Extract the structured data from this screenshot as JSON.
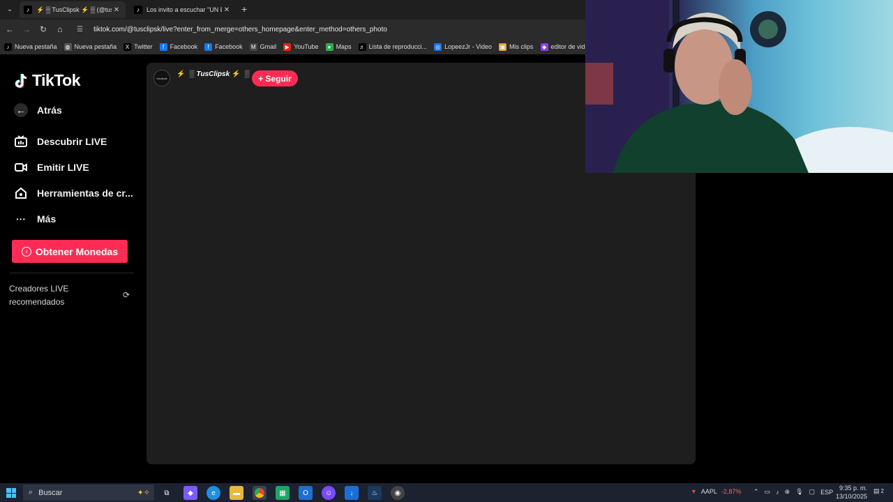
{
  "browser": {
    "tabs": [
      {
        "title": "⚡ ▒ TusClipsk ⚡ ▒ (@tusc",
        "active": true
      },
      {
        "title": "Los invito a escuchar \"UN ESCA",
        "active": false
      }
    ],
    "new_tab": "+",
    "url": "tiktok.com/@tusclipsk/live?enter_from_merge=others_homepage&enter_method=others_photo",
    "bookmarks": [
      {
        "label": "Nueva pestaña",
        "icon": "tiktok-icon"
      },
      {
        "label": "Nueva pestaña",
        "icon": "globe-icon"
      },
      {
        "label": "Twitter",
        "icon": "x-icon"
      },
      {
        "label": "Facebook",
        "icon": "facebook-icon"
      },
      {
        "label": "Facebook",
        "icon": "facebook-icon"
      },
      {
        "label": "Gmail",
        "icon": "gmail-icon"
      },
      {
        "label": "YouTube",
        "icon": "youtube-icon"
      },
      {
        "label": "Maps",
        "icon": "maps-icon"
      },
      {
        "label": "Lista de reproducci...",
        "icon": "list-icon"
      },
      {
        "label": "LopeezJr - Video",
        "icon": "chrome-icon"
      },
      {
        "label": "Mis clips",
        "icon": "clips-icon"
      },
      {
        "label": "editor de videos onl...",
        "icon": "editor-icon"
      },
      {
        "label": "",
        "icon": "px-icon"
      }
    ]
  },
  "tiktok": {
    "logo": "TikTok",
    "back": "Atrás",
    "nav": [
      {
        "label": "Descubrir LIVE",
        "icon": "live-tv-icon"
      },
      {
        "label": "Emitir LIVE",
        "icon": "camera-icon"
      },
      {
        "label": "Herramientas de cr...",
        "icon": "home-tools-icon"
      },
      {
        "label": "Más",
        "icon": "more-icon"
      }
    ],
    "coins_button": "Obtener Monedas",
    "recommended_title": "Creadores LIVE recomendados",
    "stream": {
      "streamer_name": "TusClipsk",
      "follow_label": "+ Seguir",
      "avatar_text": "tusclipsk"
    }
  },
  "taskbar": {
    "search_placeholder": "Buscar",
    "stock": {
      "symbol": "AAPL",
      "change": "-2,87%"
    },
    "lang": "ESP",
    "time": "9:35 p. m.",
    "date": "13/10/2025",
    "notifications": "2"
  },
  "colors": {
    "tiktok_red": "#fe2c55",
    "page_bg": "#000000",
    "player_bg": "#1e1e1e"
  }
}
